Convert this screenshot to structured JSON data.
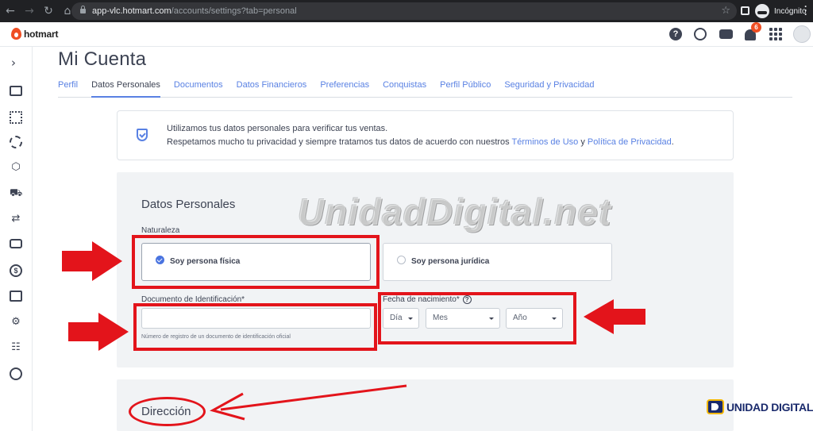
{
  "browser": {
    "url_host": "app-vlc.hotmart.com",
    "url_path": "/accounts/settings?tab=personal",
    "incognito_label": "Incógnito",
    "back_icon": "back-arrow-icon",
    "forward_icon": "forward-arrow-icon",
    "reload_icon": "reload-icon",
    "home_icon": "home-icon"
  },
  "header": {
    "logo_text": "hotmart",
    "notification_count": "6",
    "help_glyph": "?",
    "icons": [
      "help-icon",
      "smile-icon",
      "chat-icon",
      "bell-icon",
      "apps-grid-icon",
      "avatar"
    ]
  },
  "rail": {
    "expand_glyph": "›",
    "icons": [
      "dashboard-icon",
      "table-icon",
      "analytics-icon",
      "box-icon",
      "cart-icon",
      "sync-icon",
      "messages-icon",
      "dollar-icon",
      "bar-chart-icon",
      "gear-icon",
      "users-icon",
      "growth-icon"
    ]
  },
  "page": {
    "title": "Mi Cuenta",
    "tabs": [
      "Perfil",
      "Datos Personales",
      "Documentos",
      "Datos Financieros",
      "Preferencias",
      "Conquistas",
      "Perfil Público",
      "Seguridad y Privacidad"
    ],
    "active_tab": "Datos Personales"
  },
  "info": {
    "line1": "Utilizamos tus datos personales para verificar tus ventas.",
    "line2_prefix": "Respetamos mucho tu privacidad y siempre tratamos tus datos de acuerdo con nuestros ",
    "terms_link": "Términos de Uso",
    "conj": " y ",
    "privacy_link": "Política de Privacidad",
    "suffix": "."
  },
  "personal": {
    "title": "Datos Personales",
    "naturaleza_label": "Naturaleza",
    "option_fisica": "Soy persona física",
    "option_juridica": "Soy persona jurídica",
    "selected_option": "Soy persona física",
    "doc_label": "Documento de Identificación*",
    "doc_value": "",
    "doc_help": "Número de registro de un documento de identificación oficial",
    "fecha_label": "Fecha de nacimiento*",
    "fecha_help_glyph": "?",
    "dia": "Día",
    "mes": "Mes",
    "ano": "Año"
  },
  "address": {
    "title": "Dirección"
  },
  "watermarks": {
    "main": "UnidadDigital.net",
    "brand": "UNIDAD DIGITAL",
    "brand_reg": "®"
  },
  "colors": {
    "annotation_red": "#e3141b",
    "link_blue": "#5981e3",
    "brand_orange": "#ef4e23"
  }
}
